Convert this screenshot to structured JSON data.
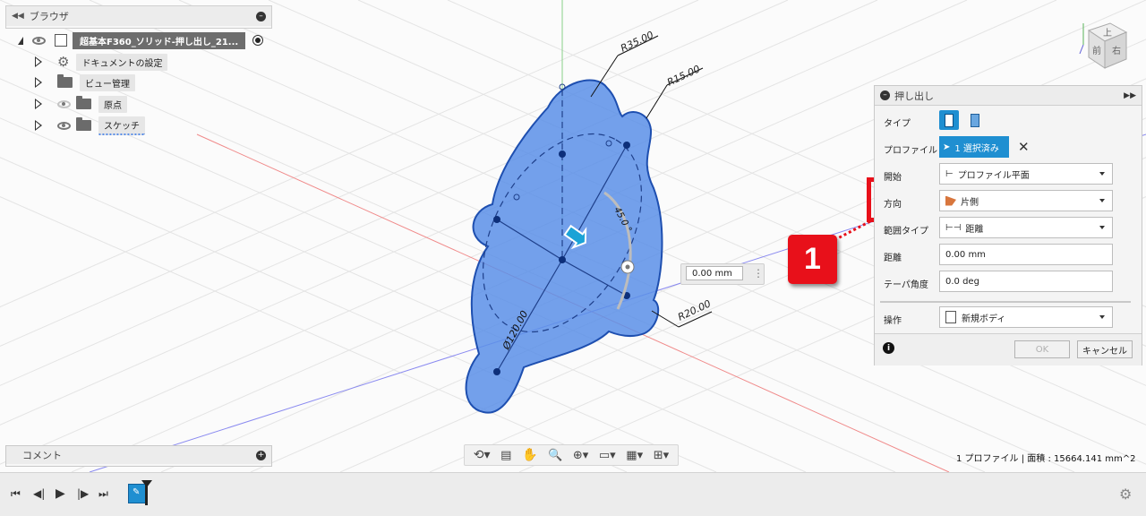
{
  "browser": {
    "title": "ブラウザ",
    "root_label": "超基本F360_ソリッド-押し出し_21...",
    "items": [
      {
        "label": "ドキュメントの設定",
        "icon": "gear-icon"
      },
      {
        "label": "ビュー管理",
        "icon": "folder-icon"
      },
      {
        "label": "原点",
        "icon": "folder-icon"
      },
      {
        "label": "スケッチ",
        "icon": "folder-icon"
      }
    ]
  },
  "comments": {
    "title": "コメント"
  },
  "canvas": {
    "dim_r35": "R35.00",
    "dim_r15": "R15.00",
    "dim_r20": "R20.00",
    "dim_dia": "Ø120.00",
    "dim_angle": "45.0 °",
    "distance_input": "0.00 mm"
  },
  "callout": {
    "number": "1",
    "color": "#e8101a"
  },
  "extrude_panel": {
    "title": "押し出し",
    "rows": {
      "type_label": "タイプ",
      "profile_label": "プロファイル",
      "profile_value": "1 選択済み",
      "start_label": "開始",
      "start_value": "プロファイル平面",
      "direction_label": "方向",
      "direction_value": "片側",
      "extent_label": "範囲タイプ",
      "extent_value": "距離",
      "distance_label": "距離",
      "distance_value": "0.00 mm",
      "taper_label": "テーパ角度",
      "taper_value": "0.0 deg",
      "operation_label": "操作",
      "operation_value": "新規ボディ"
    },
    "ok_label": "OK",
    "cancel_label": "キャンセル"
  },
  "status_text": "1 プロファイル | 面積 : 15664.141 mm^2",
  "viewcube": {
    "top_label": "上",
    "front_label": "前",
    "right_label": "右"
  },
  "colors": {
    "sketch_fill": "#5b8fe8",
    "accent": "#1f8fd1",
    "highlight_box": "#e8101a"
  }
}
